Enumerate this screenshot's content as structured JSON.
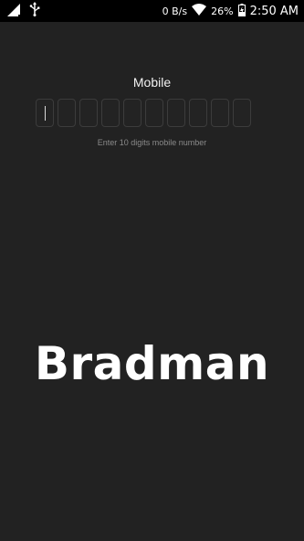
{
  "status_bar": {
    "icons_left": [
      "signal-icon",
      "usb-icon"
    ],
    "net_speed": "0 B/s",
    "battery_percent": "26%",
    "time": "2:50 AM"
  },
  "form": {
    "label": "Mobile",
    "digit_count": 10,
    "hint": "Enter 10 digits mobile number"
  },
  "brand": {
    "name": "Bradman"
  }
}
